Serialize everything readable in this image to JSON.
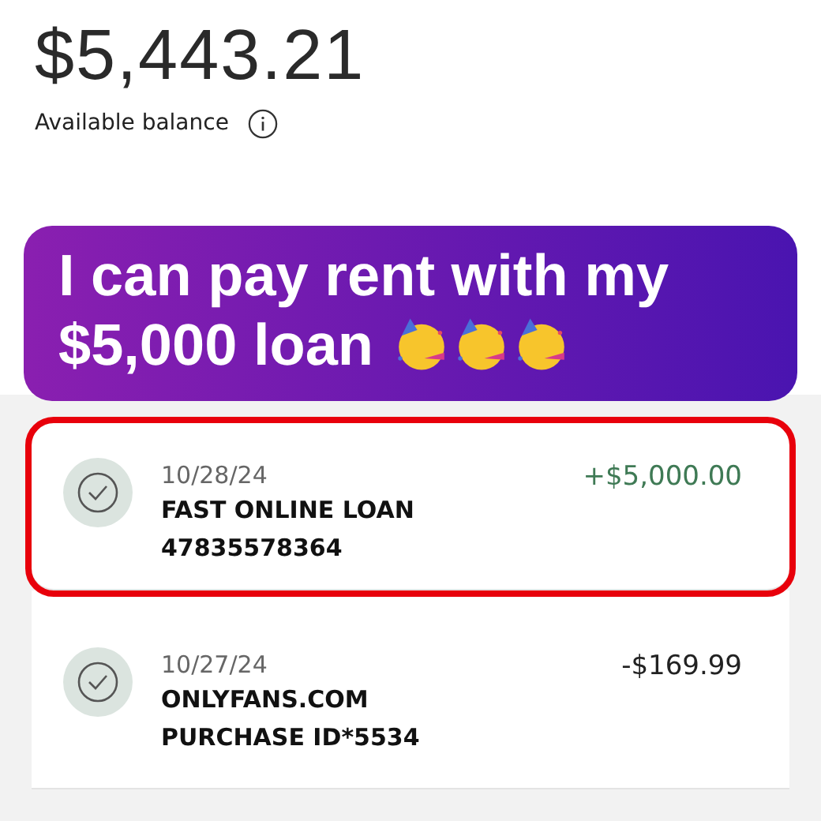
{
  "balance": {
    "amount": "$5,443.21",
    "label": "Available balance"
  },
  "caption": {
    "text": "I can pay rent with my $5,000 loan",
    "emojis": [
      {
        "kind": "party-face"
      },
      {
        "kind": "party-face"
      },
      {
        "kind": "party-face"
      }
    ]
  },
  "transactions": [
    {
      "date": "10/28/24",
      "lines": [
        "FAST ONLINE LOAN",
        "47835578364"
      ],
      "amount": "+$5,000.00",
      "kind": "credit",
      "highlighted": true
    },
    {
      "date": "10/27/24",
      "lines": [
        "ONLYFANS.COM",
        "PURCHASE ID*5534"
      ],
      "amount": "-$169.99",
      "kind": "debit",
      "highlighted": false
    }
  ]
}
